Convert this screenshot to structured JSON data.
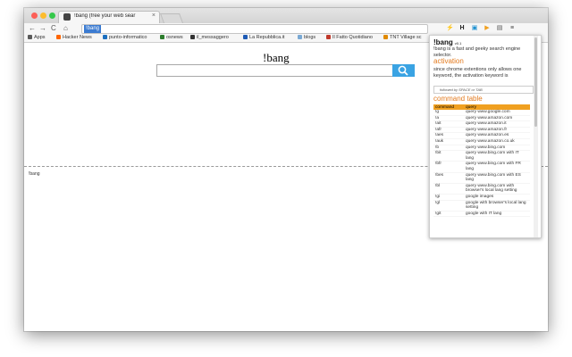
{
  "browser": {
    "tab_title": "!bang (free your web sear",
    "tab_close": "×",
    "omnibox_text": "!bang",
    "nav": {
      "back": "←",
      "forward": "→",
      "reload": "C",
      "home": "⌂"
    },
    "extensions": [
      "⚡",
      "H",
      "▣",
      "▶",
      "▤",
      "≡"
    ]
  },
  "bookmarks": [
    {
      "label": "Apps",
      "color": "#5a5a5a"
    },
    {
      "label": "Hacker News",
      "color": "#ff6600"
    },
    {
      "label": "punto-informatico",
      "color": "#1c6fbf"
    },
    {
      "label": "osnews",
      "color": "#2d7d2d"
    },
    {
      "label": "il_messaggero",
      "color": "#333333"
    },
    {
      "label": "La Repubblica.it",
      "color": "#1e5bb5"
    },
    {
      "label": "blogs",
      "color": "#7aa9d4"
    },
    {
      "label": "Il Fatto Quotidiano",
      "color": "#c0392b"
    },
    {
      "label": "TNT Village sc",
      "color": "#e08a00"
    }
  ],
  "page": {
    "title": "!bang",
    "footer_text": "!bang"
  },
  "popup": {
    "title": "!bang",
    "version": "v0.1",
    "description": "!bang is a fast and geeky search engine selector.",
    "activation_heading": "activation",
    "activation_text": "since chrome extentions only allows one keyword, the activation keyword is",
    "note": "followed by SPACE or TAB",
    "table_heading": "command table",
    "table_header": {
      "command": "command",
      "query": "query"
    },
    "commands": [
      {
        "command": "!g",
        "query": "query www.google.com"
      },
      {
        "command": "!a",
        "query": "query www.amazon.com"
      },
      {
        "command": "!ait",
        "query": "query www.amazon.it"
      },
      {
        "command": "!afr",
        "query": "query www.amazon.fr"
      },
      {
        "command": "!aes",
        "query": "query www.amazon.es"
      },
      {
        "command": "!auk",
        "query": "query www.amazon.co.uk"
      },
      {
        "command": "!b",
        "query": "query www.bing.com"
      },
      {
        "command": "!bit",
        "query": "query www.bing.com with IT lang"
      },
      {
        "command": "!bfr",
        "query": "query www.bing.com with FR lang"
      },
      {
        "command": "!bes",
        "query": "query www.bing.com with ES lang"
      },
      {
        "command": "!bl",
        "query": "query www.bing.com with browser's local lang setting"
      },
      {
        "command": "!gi",
        "query": "google images"
      },
      {
        "command": "!gl",
        "query": "google with browser's local lang setting"
      },
      {
        "command": "!git",
        "query": "google with IT lang"
      }
    ]
  }
}
